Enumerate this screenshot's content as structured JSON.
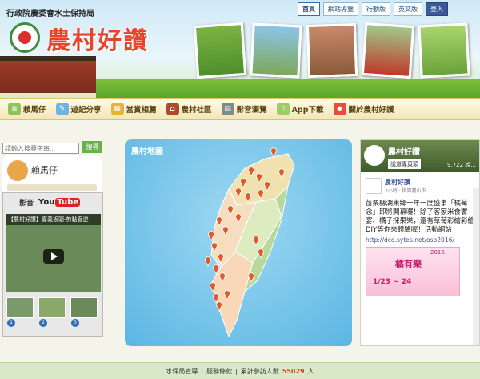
{
  "header": {
    "agency": "行政院農委會水土保持局",
    "brand": "農村好讚",
    "topnav": [
      {
        "label": "首頁"
      },
      {
        "label": "網站導覽"
      },
      {
        "label": "行動版"
      },
      {
        "label": "英文版"
      },
      {
        "label": "登入"
      }
    ]
  },
  "menu": [
    {
      "label": "賴馬仔",
      "icon": "book-icon"
    },
    {
      "label": "遊記分享",
      "icon": "edit-icon"
    },
    {
      "label": "當賞相薦",
      "icon": "album-icon"
    },
    {
      "label": "農村社區",
      "icon": "house-icon"
    },
    {
      "label": "影音瀏覽",
      "icon": "film-icon"
    },
    {
      "label": "App下載",
      "icon": "phone-icon"
    },
    {
      "label": "關於農村好讚",
      "icon": "tag-icon"
    }
  ],
  "search": {
    "placeholder": "請輸入搜尋字串...",
    "button": "搜尋"
  },
  "character": {
    "name": "賴馬仔"
  },
  "video": {
    "section_title": "影音",
    "youtube_label": "You",
    "youtube_tube": "Tube",
    "title": "【農村好讚】嘉義板頭-剪黏直逆",
    "thumbs": [
      "1",
      "2",
      "3"
    ]
  },
  "map": {
    "title": "農村地圖",
    "pins": 26
  },
  "facebook": {
    "page_name": "農村好讚",
    "like_button": "說道專頁頭",
    "likes": "9,722 說...",
    "post_author": "農村好讚",
    "post_time": "2小時 · 桃園農山市",
    "post_text": "苗栗縣湖東鄉一年一度盛事「橘莓念」即將開幕囉！除了客家米食饗宴、橘子採果樂，還有草莓彩繪彩繪DIY等你來體驗喔！活動網站",
    "post_link": "http://dcd.sytes.net/osb2016/",
    "image_title": "橘有樂",
    "image_year": "2016",
    "image_date": "1/23 ~ 24"
  },
  "footer": {
    "privacy": "水保局宣導",
    "service": "服務條款",
    "visits_label": "累計參訪人數",
    "visits_value": "55029",
    "visits_unit": "人"
  },
  "colors": {
    "accent_green": "#6ab04c",
    "brand_red": "#e8442c",
    "map_blue": "#5bb6e3",
    "pin_red": "#e05a2a"
  }
}
